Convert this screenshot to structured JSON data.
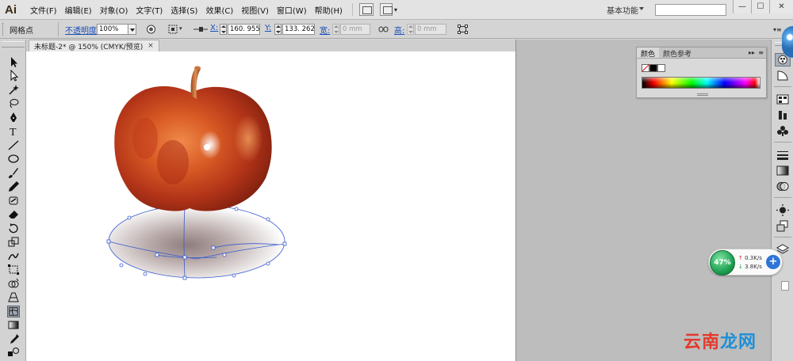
{
  "app": {
    "logo": "Ai"
  },
  "menu": {
    "items": [
      "文件(F)",
      "编辑(E)",
      "对象(O)",
      "文字(T)",
      "选择(S)",
      "效果(C)",
      "视图(V)",
      "窗口(W)",
      "帮助(H)"
    ],
    "workspace": "基本功能",
    "search_value": ""
  },
  "window_controls": {
    "minimize": "—",
    "restore": "☐",
    "close": "✕"
  },
  "control_bar": {
    "selection_label": "网格点",
    "opacity_label": "不透明度",
    "opacity_value": "100%",
    "x_label": "X:",
    "x_value": "160. 955 r",
    "y_label": "Y:",
    "y_value": "133. 262 r",
    "width_label": "宽:",
    "width_value": "0 mm",
    "height_label": "高:",
    "height_value": "0 mm"
  },
  "document_tab": {
    "title": "未标题-2* @ 150% (CMYK/预览)",
    "close": "×"
  },
  "tools": [
    "selection-tool",
    "direct-selection-tool",
    "magic-wand-tool",
    "lasso-tool",
    "pen-tool",
    "type-tool",
    "line-segment-tool",
    "ellipse-tool",
    "paintbrush-tool",
    "pencil-tool",
    "blob-brush-tool",
    "eraser-tool",
    "rotate-tool",
    "scale-tool",
    "warp-tool",
    "free-transform-tool",
    "shape-builder-tool",
    "perspective-grid-tool",
    "mesh-tool",
    "gradient-tool",
    "eyedropper-tool",
    "blend-tool"
  ],
  "active_tool": "mesh-tool",
  "color_panel": {
    "tabs": [
      "颜色",
      "颜色参考"
    ],
    "active_tab": "颜色",
    "menu": "▸▸",
    "menu2": "≡"
  },
  "dock_icons": [
    "color-panel-icon",
    "color-guide-icon",
    "swatches-icon",
    "brushes-icon",
    "symbols-icon",
    "stroke-icon",
    "gradient-panel-icon",
    "transparency-icon",
    "appearance-icon",
    "graphic-styles-icon",
    "layers-icon"
  ],
  "net_widget": {
    "percent": "47%",
    "up_speed": "0.3K/s",
    "down_speed": "3.8K/s",
    "plus": "+"
  },
  "watermark": {
    "part1": "云南",
    "part2": "龙网"
  },
  "colors": {
    "apple_red": "#c8381a",
    "apple_orange": "#e2631f",
    "mesh_line": "#3a5bd0",
    "shadow_gray": "#9b8e8c"
  }
}
